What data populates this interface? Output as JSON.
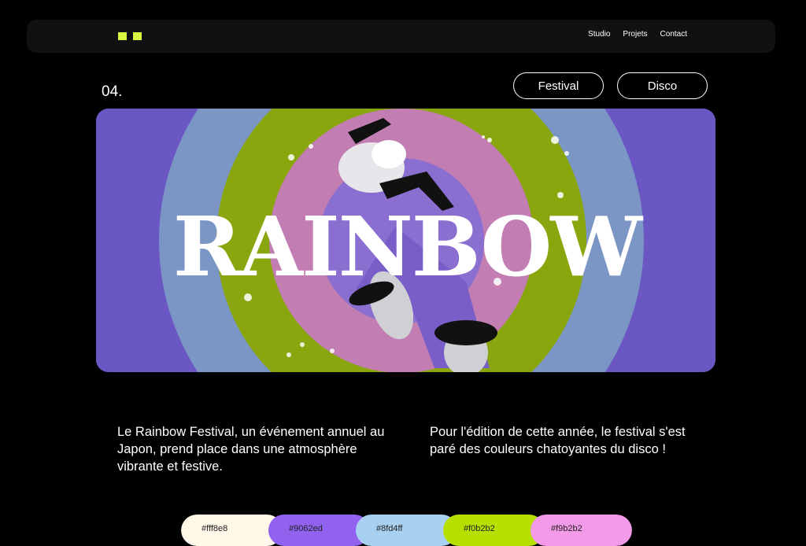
{
  "nav": {
    "links": [
      "Studio",
      "Projets",
      "Contact"
    ]
  },
  "project": {
    "number": "04.",
    "tags": [
      "Festival",
      "Disco"
    ],
    "hero_title": "RAINBOW",
    "description_left": "Le Rainbow Festival, un événement annuel au Japon, prend place dans une atmosphère vibrante et festive.",
    "description_right": "Pour l'édition de cette année, le festival s'est paré des couleurs chatoyantes du disco !"
  },
  "palette": [
    {
      "label": "#fff8e8",
      "color": "#fff8e8"
    },
    {
      "label": "#9062ed",
      "color": "#9062ed"
    },
    {
      "label": "#8fd4ff",
      "color": "#a8d0f0"
    },
    {
      "label": "#f0b2b2",
      "color": "#b6e000"
    },
    {
      "label": "#f9b2b2",
      "color": "#f39ae8"
    }
  ],
  "colors": {
    "accent": "#d9f542",
    "hero_bg": "#6a57c4",
    "ring_blue": "#7b95c4",
    "ring_green": "#8aa60e",
    "ring_pink": "#c27db2",
    "ring_center": "#8a6fd0"
  }
}
